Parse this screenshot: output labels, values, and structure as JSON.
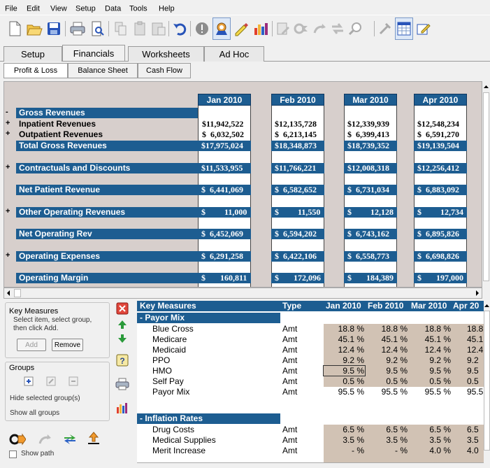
{
  "menu": [
    "File",
    "Edit",
    "View",
    "Setup",
    "Data",
    "Tools",
    "Help"
  ],
  "toolbar_icons": [
    "new-icon",
    "open-icon",
    "save-icon",
    "print-icon",
    "print-preview-icon",
    "copy-icon",
    "paste-icon",
    "paste-special-icon",
    "undo-icon",
    "stop-icon",
    "audit-icon",
    "highlight-icon",
    "chart-icon",
    "edit-icon",
    "go-icon",
    "redo-icon",
    "swap-icon",
    "find-icon",
    "tools-icon",
    "grid-icon",
    "edit-note-icon"
  ],
  "main_tabs": [
    "Setup",
    "Financials",
    "Worksheets",
    "Ad Hoc"
  ],
  "active_main_tab": "Financials",
  "sub_tabs": [
    "Profit & Loss",
    "Balance Sheet",
    "Cash Flow"
  ],
  "active_sub_tab": "Profit & Loss",
  "pl": {
    "months": [
      "Jan 2010",
      "Feb 2010",
      "Mar 2010",
      "Apr 2010"
    ],
    "rows": [
      {
        "sign": "-",
        "label": "Gross Revenues",
        "values": [
          "",
          "",
          "",
          ""
        ],
        "style": "blue"
      },
      {
        "sign": "+",
        "label": "Inpatient Revenues",
        "values": [
          "$11,942,522",
          "$12,135,728",
          "$12,339,939",
          "$12,548,234"
        ],
        "style": "plain"
      },
      {
        "sign": "+",
        "label": "Outpatient Revenues",
        "values": [
          "$  6,032,502",
          "$  6,213,145",
          "$  6,399,413",
          "$  6,591,270"
        ],
        "style": "plain"
      },
      {
        "sign": "",
        "label": "Total Gross Revenues",
        "values": [
          "$17,975,024",
          "$18,348,873",
          "$18,739,352",
          "$19,139,504"
        ],
        "style": "blue"
      },
      {
        "sign": "+",
        "label": "Contractuals and Discounts",
        "values": [
          "$11,533,955",
          "$11,766,221",
          "$12,008,318",
          "$12,256,412"
        ],
        "style": "blue"
      },
      {
        "sign": "",
        "label": "Net Patient Revenue",
        "values": [
          "$  6,441,069",
          "$  6,582,652",
          "$  6,731,034",
          "$  6,883,092"
        ],
        "style": "blue"
      },
      {
        "sign": "+",
        "label": "Other Operating Revenues",
        "values": [
          "$         11,000",
          "$         11,550",
          "$         12,128",
          "$         12,734"
        ],
        "style": "blue"
      },
      {
        "sign": "",
        "label": "Net Operating Rev",
        "values": [
          "$  6,452,069",
          "$  6,594,202",
          "$  6,743,162",
          "$  6,895,826"
        ],
        "style": "blue"
      },
      {
        "sign": "+",
        "label": "Operating Expenses",
        "values": [
          "$  6,291,258",
          "$  6,422,106",
          "$  6,558,773",
          "$  6,698,826"
        ],
        "style": "blue"
      },
      {
        "sign": "",
        "label": "Operating Margin",
        "values": [
          "$       160,811",
          "$       172,096",
          "$       184,389",
          "$       197,000"
        ],
        "style": "blue"
      }
    ]
  },
  "left_panel": {
    "key_measures_title": "Key Measures",
    "instructions": "Select item, select group, then click Add.",
    "add_label": "Add",
    "remove_label": "Remove",
    "groups_title": "Groups",
    "hide_selected": "Hide selected group(s)",
    "show_all": "Show all groups",
    "show_path": "Show path"
  },
  "km": {
    "headers": [
      "Key Measures",
      "Type",
      "Jan 2010",
      "Feb 2010",
      "Mar 2010",
      "Apr 20"
    ],
    "groups": [
      {
        "name": "- Payor Mix",
        "rows": [
          {
            "label": "Blue Cross",
            "type": "Amt",
            "values": [
              "18.8 %",
              "18.8 %",
              "18.8 %",
              "18.8"
            ]
          },
          {
            "label": "Medicare",
            "type": "Amt",
            "values": [
              "45.1 %",
              "45.1 %",
              "45.1 %",
              "45.1"
            ]
          },
          {
            "label": "Medicaid",
            "type": "Amt",
            "values": [
              "12.4 %",
              "12.4 %",
              "12.4 %",
              "12.4"
            ]
          },
          {
            "label": "PPO",
            "type": "Amt",
            "values": [
              "9.2 %",
              "9.2 %",
              "9.2 %",
              "9.2"
            ]
          },
          {
            "label": "HMO",
            "type": "Amt",
            "values": [
              "9.5 %",
              "9.5 %",
              "9.5 %",
              "9.5"
            ]
          },
          {
            "label": "Self Pay",
            "type": "Amt",
            "values": [
              "0.5 %",
              "0.5 %",
              "0.5 %",
              "0.5"
            ]
          },
          {
            "label": "Payor Mix",
            "type": "Amt",
            "values": [
              "95.5 %",
              "95.5 %",
              "95.5 %",
              "95.5"
            ],
            "total": true
          }
        ]
      },
      {
        "name": "- Inflation Rates",
        "rows": [
          {
            "label": "Drug Costs",
            "type": "Amt",
            "values": [
              "6.5 %",
              "6.5 %",
              "6.5 %",
              "6.5"
            ]
          },
          {
            "label": "Medical Supplies",
            "type": "Amt",
            "values": [
              "3.5 %",
              "3.5 %",
              "3.5 %",
              "3.5"
            ]
          },
          {
            "label": "Merit Increase",
            "type": "Amt",
            "values": [
              "- %",
              "- %",
              "4.0 %",
              "4.0"
            ]
          }
        ]
      }
    ]
  }
}
